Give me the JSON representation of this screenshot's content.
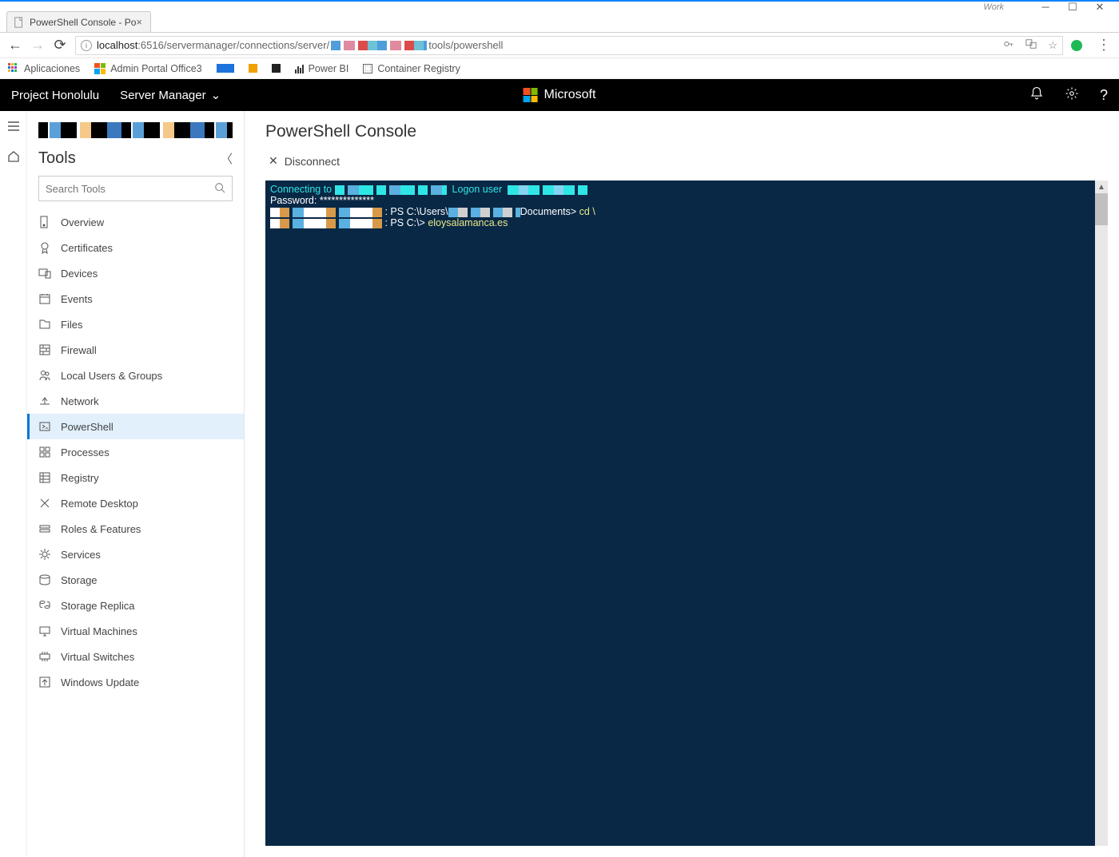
{
  "window": {
    "label": "Work"
  },
  "browser": {
    "tab_title": "PowerShell Console - Po",
    "url_prefix": "localhost",
    "url_port_path": ":6516/servermanager/connections/server/",
    "url_suffix": "tools/powershell",
    "bookmarks": {
      "apps": "Aplicaciones",
      "admin": "Admin Portal Office3",
      "powerbi": "Power BI",
      "registry": "Container Registry"
    }
  },
  "topbar": {
    "brand": "Project Honolulu",
    "crumb": "Server Manager",
    "ms": "Microsoft"
  },
  "sidebar": {
    "heading": "Tools",
    "search_placeholder": "Search Tools",
    "items": [
      {
        "label": "Overview"
      },
      {
        "label": "Certificates"
      },
      {
        "label": "Devices"
      },
      {
        "label": "Events"
      },
      {
        "label": "Files"
      },
      {
        "label": "Firewall"
      },
      {
        "label": "Local Users & Groups"
      },
      {
        "label": "Network"
      },
      {
        "label": "PowerShell"
      },
      {
        "label": "Processes"
      },
      {
        "label": "Registry"
      },
      {
        "label": "Remote Desktop"
      },
      {
        "label": "Roles & Features"
      },
      {
        "label": "Services"
      },
      {
        "label": "Storage"
      },
      {
        "label": "Storage Replica"
      },
      {
        "label": "Virtual Machines"
      },
      {
        "label": "Virtual Switches"
      },
      {
        "label": "Windows Update"
      }
    ]
  },
  "content": {
    "title": "PowerShell Console",
    "disconnect": "Disconnect"
  },
  "terminal": {
    "connecting": "Connecting to ",
    "logon": "  Logon user  ",
    "password": "Password: **************",
    "prompt1a": " : PS C:\\Users\\",
    "prompt1b": "Documents> ",
    "cmd1": "cd \\",
    "prompt2": " : PS C:\\> ",
    "cmd2": "eloysalamanca.es"
  }
}
